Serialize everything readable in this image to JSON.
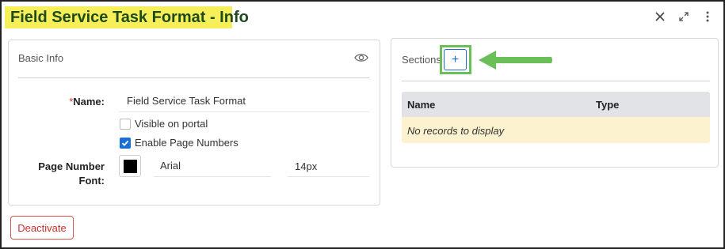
{
  "header": {
    "title": "Field Service Task Format - Info",
    "close_icon": "close-icon",
    "expand_icon": "expand-icon",
    "more_icon": "more-vertical-icon"
  },
  "basic_info": {
    "title": "Basic Info",
    "name_required_mark": "*",
    "name_label": "Name:",
    "name_value": "Field Service Task Format",
    "visible_on_portal_label": "Visible on portal",
    "visible_on_portal_checked": false,
    "enable_page_numbers_label": "Enable Page Numbers",
    "enable_page_numbers_checked": true,
    "page_number_font_label_line1": "Page Number",
    "page_number_font_label_line2": "Font:",
    "font_color": "#000000",
    "font_family": "Arial",
    "font_size": "14px"
  },
  "sections": {
    "title": "Sections",
    "add_label": "+",
    "columns": [
      "Name",
      "Type"
    ],
    "empty_message": "No records to display"
  },
  "footer": {
    "deactivate_label": "Deactivate"
  },
  "colors": {
    "highlight_yellow": "#f7ef5a",
    "title_green": "#1e4b1c",
    "callout_green": "#6bbf59",
    "accent_blue": "#1a6fd6",
    "danger_red": "#c9302c",
    "empty_row_bg": "#fcf2cf"
  }
}
